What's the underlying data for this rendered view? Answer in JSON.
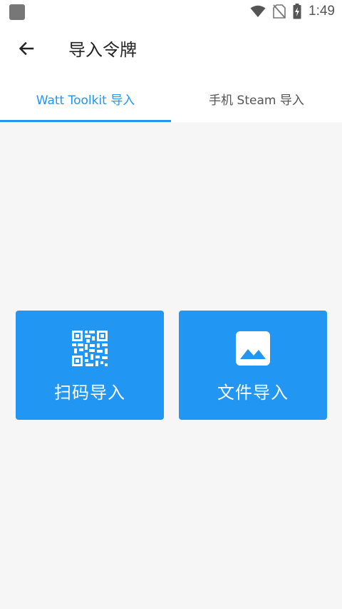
{
  "status_bar": {
    "time": "1:49",
    "icons": [
      "wifi-icon",
      "no-sim-icon",
      "battery-charging-icon"
    ]
  },
  "app_bar": {
    "back_icon": "arrow-left-icon",
    "title": "导入令牌"
  },
  "tabs": [
    {
      "label": "Watt Toolkit 导入",
      "active": true
    },
    {
      "label": "手机 Steam 导入",
      "active": false
    }
  ],
  "actions": [
    {
      "label": "扫码导入",
      "icon": "qr-code-icon"
    },
    {
      "label": "文件导入",
      "icon": "image-icon"
    }
  ],
  "colors": {
    "accent": "#2196f3",
    "background": "#f6f6f6",
    "surface": "#ffffff"
  }
}
